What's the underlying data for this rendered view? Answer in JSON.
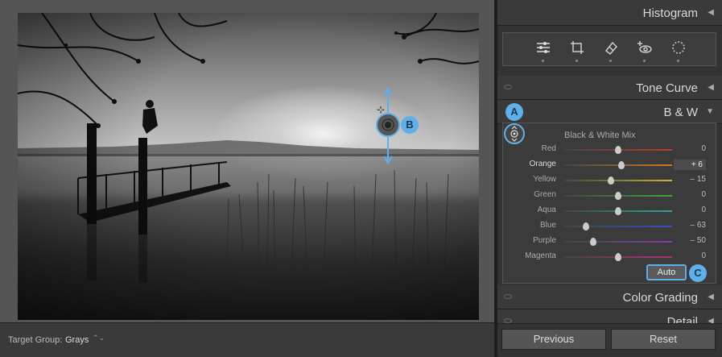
{
  "canvas": {
    "target_group_label": "Target Group:",
    "target_group_value": "Grays",
    "target_group_arrows": "⌃⌄"
  },
  "panel": {
    "histogram": {
      "title": "Histogram",
      "toggle": "◀"
    },
    "tone_curve": {
      "title": "Tone Curve",
      "toggle": "◀"
    },
    "bw": {
      "title": "B & W",
      "toggle": "▼"
    },
    "color_grading": {
      "title": "Color Grading",
      "toggle": "◀"
    },
    "detail": {
      "title": "Detail",
      "toggle": "◀"
    },
    "mix_title": "Black & White Mix",
    "rows": [
      {
        "label": "Red",
        "value": "0",
        "level": 0.5,
        "color": "#c0392b"
      },
      {
        "label": "Orange",
        "value": "+ 6",
        "level": 0.53,
        "color": "#d07a20"
      },
      {
        "label": "Yellow",
        "value": "– 15",
        "level": 0.43,
        "color": "#c9b820"
      },
      {
        "label": "Green",
        "value": "0",
        "level": 0.5,
        "color": "#3aa83a"
      },
      {
        "label": "Aqua",
        "value": "0",
        "level": 0.5,
        "color": "#2ba59a"
      },
      {
        "label": "Blue",
        "value": "– 63",
        "level": 0.2,
        "color": "#3050c0"
      },
      {
        "label": "Purple",
        "value": "– 50",
        "level": 0.27,
        "color": "#8a3ab0"
      },
      {
        "label": "Magenta",
        "value": "0",
        "level": 0.5,
        "color": "#b0307a"
      }
    ],
    "auto_label": "Auto"
  },
  "footer": {
    "previous": "Previous",
    "reset": "Reset"
  },
  "callouts": {
    "a": "A",
    "b": "B",
    "c": "C"
  },
  "accent": "#5fb0e8"
}
